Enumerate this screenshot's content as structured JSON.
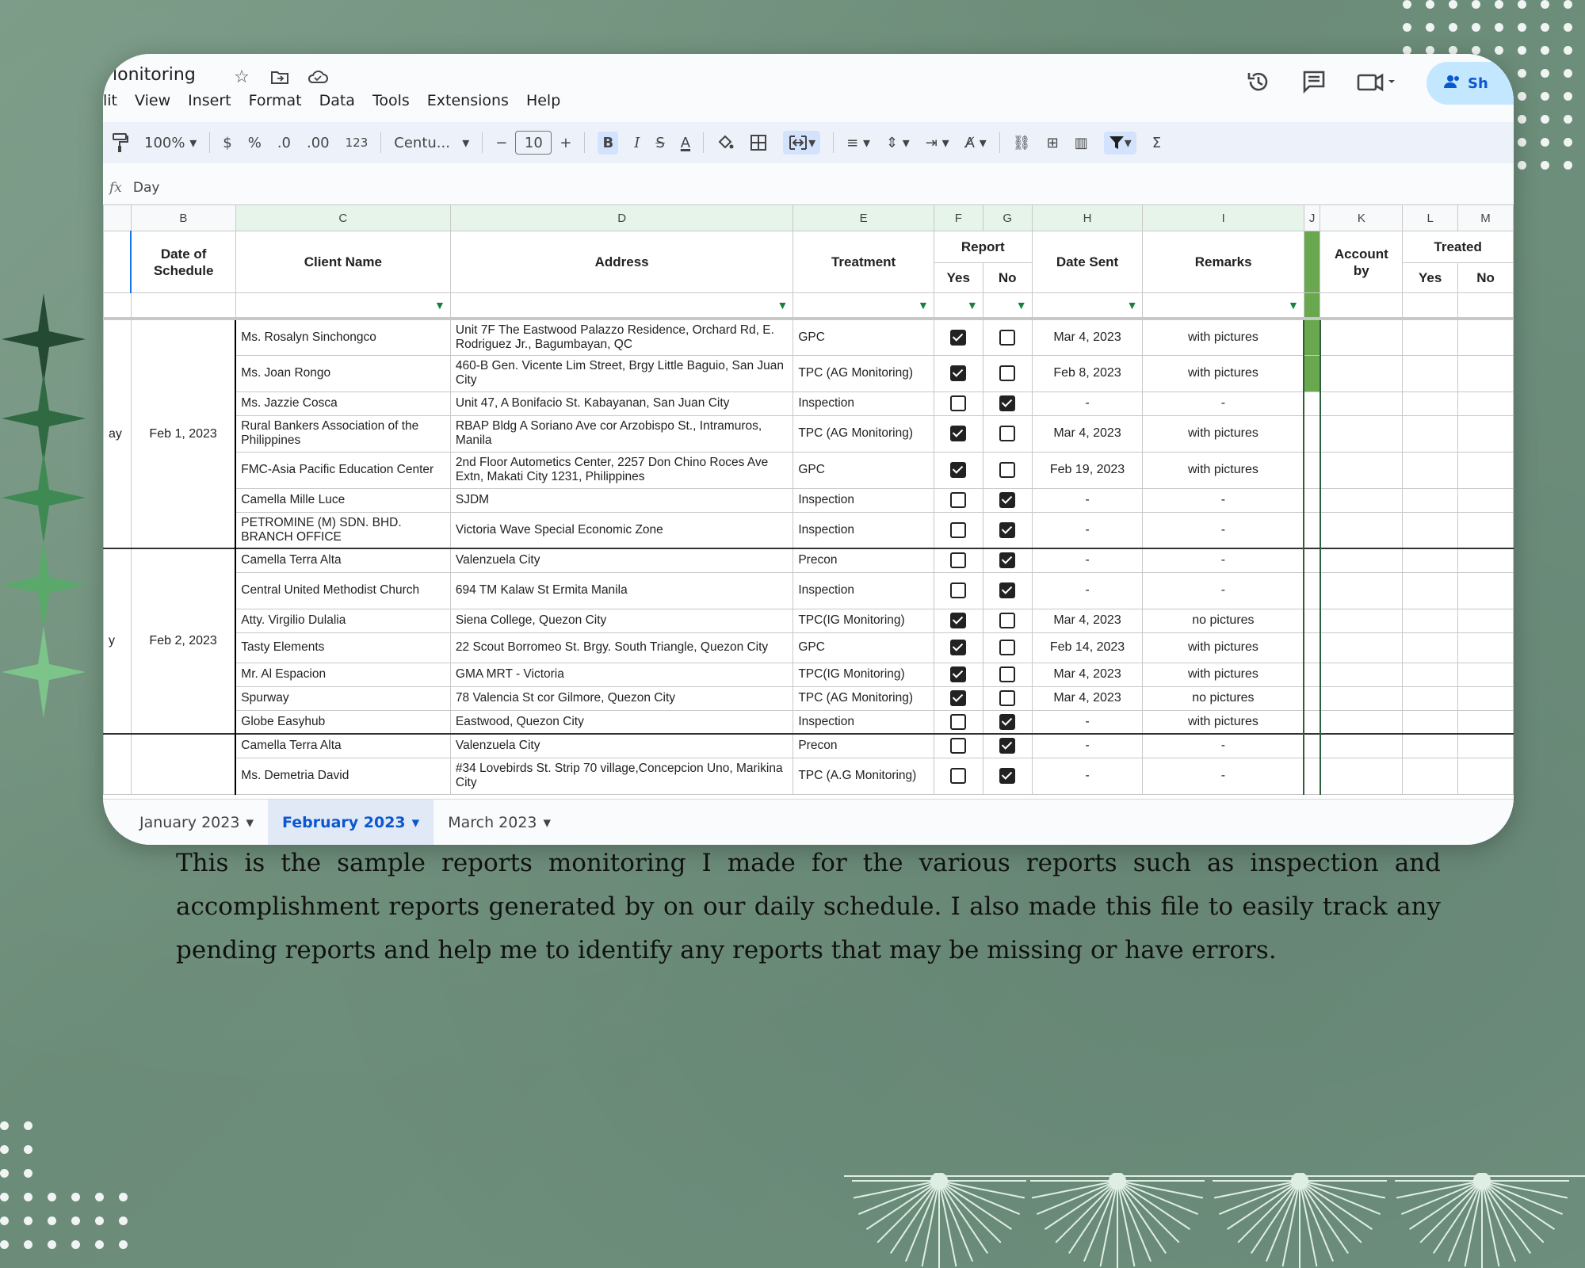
{
  "doc": {
    "title": "lonitoring",
    "menu": [
      "lit",
      "View",
      "Insert",
      "Format",
      "Data",
      "Tools",
      "Extensions",
      "Help"
    ],
    "share_label": "Sh"
  },
  "toolbar": {
    "zoom": "100%",
    "currency": "$",
    "percent": "%",
    "dec_decrease": ".0",
    "dec_increase": ".00",
    "number_format": "123",
    "font": "Centu...",
    "font_size": "10",
    "bold": "B",
    "italic": "I",
    "strike": "S",
    "text_color": "A"
  },
  "formula_bar": {
    "fx": "fx",
    "value": "Day"
  },
  "columns": [
    "B",
    "C",
    "D",
    "E",
    "F",
    "G",
    "H",
    "I",
    "J",
    "K",
    "L",
    "M"
  ],
  "headers": {
    "date_of_schedule": "Date of Schedule",
    "client_name": "Client Name",
    "address": "Address",
    "treatment": "Treatment",
    "report": "Report",
    "yes": "Yes",
    "no": "No",
    "date_sent": "Date Sent",
    "remarks": "Remarks",
    "account_by": "Account by",
    "treated": "Treated"
  },
  "groups": [
    {
      "day": "ay",
      "date": "Feb 1, 2023",
      "rows": [
        {
          "client": "Ms. Rosalyn Sinchongco",
          "address": "Unit 7F The Eastwood Palazzo Residence, Orchard Rd, E. Rodriguez Jr., Bagumbayan, QC",
          "treatment": "GPC",
          "yes": true,
          "no": false,
          "date_sent": "Mar 4, 2023",
          "remarks": "with pictures"
        },
        {
          "client": "Ms. Joan Rongo",
          "address": "460-B Gen. Vicente Lim Street, Brgy Little Baguio, San Juan City",
          "treatment": "TPC (AG Monitoring)",
          "yes": true,
          "no": false,
          "date_sent": "Feb 8, 2023",
          "remarks": "with pictures"
        },
        {
          "client": "Ms. Jazzie Cosca",
          "address": "Unit 47, A Bonifacio St. Kabayanan, San Juan City",
          "treatment": "Inspection",
          "yes": false,
          "no": true,
          "date_sent": "-",
          "remarks": "-"
        },
        {
          "client": "Rural Bankers Association of the Philippines",
          "address": "RBAP Bldg A Soriano Ave cor Arzobispo St., Intramuros, Manila",
          "treatment": "TPC (AG Monitoring)",
          "yes": true,
          "no": false,
          "date_sent": "Mar 4, 2023",
          "remarks": "with pictures"
        },
        {
          "client": "FMC-Asia Pacific Education Center",
          "address": "2nd Floor Autometics Center, 2257 Don Chino Roces Ave Extn, Makati City 1231, Philippines",
          "treatment": "GPC",
          "yes": true,
          "no": false,
          "date_sent": "Feb 19, 2023",
          "remarks": "with pictures"
        },
        {
          "client": "Camella Mille Luce",
          "address": "SJDM",
          "treatment": "Inspection",
          "yes": false,
          "no": true,
          "date_sent": "-",
          "remarks": "-"
        },
        {
          "client": "PETROMINE (M) SDN. BHD. BRANCH OFFICE",
          "address": "Victoria Wave Special Economic Zone",
          "treatment": "Inspection",
          "yes": false,
          "no": true,
          "date_sent": "-",
          "remarks": "-"
        }
      ]
    },
    {
      "day": "y",
      "date": "Feb 2, 2023",
      "rows": [
        {
          "client": "Camella Terra Alta",
          "address": "Valenzuela City",
          "treatment": "Precon",
          "yes": false,
          "no": true,
          "date_sent": "-",
          "remarks": "-"
        },
        {
          "client": "Central United Methodist Church",
          "address": "694 TM Kalaw St Ermita Manila",
          "treatment": "Inspection",
          "yes": false,
          "no": true,
          "date_sent": "-",
          "remarks": "-"
        },
        {
          "client": "Atty. Virgilio Dulalia",
          "address": "Siena College, Quezon City",
          "treatment": "TPC(IG Monitoring)",
          "yes": true,
          "no": false,
          "date_sent": "Mar 4, 2023",
          "remarks": "no pictures"
        },
        {
          "client": "Tasty Elements",
          "address": "22 Scout Borromeo St. Brgy. South Triangle, Quezon City",
          "treatment": "GPC",
          "yes": true,
          "no": false,
          "date_sent": "Feb 14, 2023",
          "remarks": "with pictures"
        },
        {
          "client": "Mr. Al Espacion",
          "address": "GMA MRT - Victoria",
          "treatment": "TPC(IG Monitoring)",
          "yes": true,
          "no": false,
          "date_sent": "Mar 4, 2023",
          "remarks": "with pictures"
        },
        {
          "client": "Spurway",
          "address": "78 Valencia St cor Gilmore, Quezon City",
          "treatment": "TPC (AG Monitoring)",
          "yes": true,
          "no": false,
          "date_sent": "Mar 4, 2023",
          "remarks": "no pictures"
        },
        {
          "client": "Globe Easyhub",
          "address": "Eastwood, Quezon City",
          "treatment": "Inspection",
          "yes": false,
          "no": true,
          "date_sent": "-",
          "remarks": "with pictures"
        }
      ]
    },
    {
      "day": "",
      "date": "",
      "rows": [
        {
          "client": "Camella Terra Alta",
          "address": "Valenzuela City",
          "treatment": "Precon",
          "yes": false,
          "no": true,
          "date_sent": "-",
          "remarks": "-"
        },
        {
          "client": "Ms. Demetria David",
          "address": "#34 Lovebirds St. Strip 70 village,Concepcion Uno, Marikina City",
          "treatment": "TPC (A.G Monitoring)",
          "yes": false,
          "no": true,
          "date_sent": "-",
          "remarks": "-"
        }
      ]
    }
  ],
  "sheet_tabs": [
    "January 2023",
    "February 2023",
    "March 2023"
  ],
  "active_tab": "February 2023",
  "caption": "This is the sample reports monitoring I made for the various reports such as inspection and accomplishment reports generated by on our daily schedule. I also made this file to easily track any pending reports and help me to identify any reports that may be missing or have errors."
}
